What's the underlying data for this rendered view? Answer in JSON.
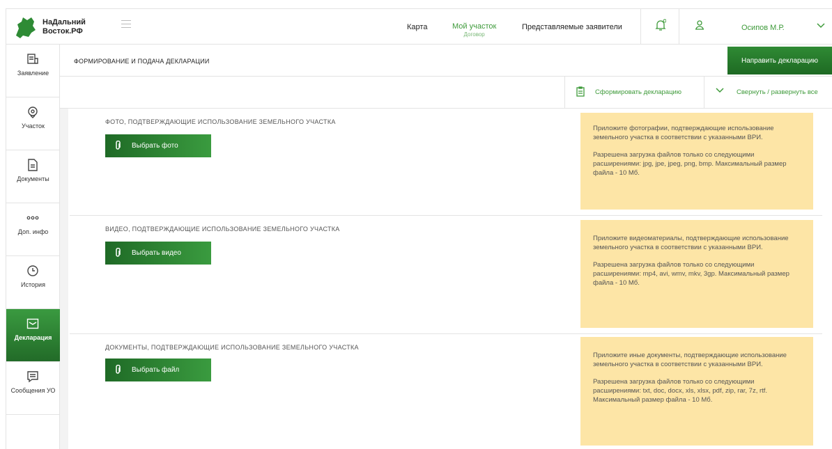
{
  "header": {
    "brand_line1": "НаДальний",
    "brand_line2": "Восток.РФ",
    "nav_map": "Карта",
    "nav_plot": "Мой участок",
    "nav_plot_sub": "Договор",
    "nav_applicants": "Представляемые заявители",
    "user_name": "Осипов М.Р."
  },
  "sidebar": {
    "items": [
      {
        "label": "Заявление",
        "icon": "application-icon"
      },
      {
        "label": "Участок",
        "icon": "location-pin-icon"
      },
      {
        "label": "Документы",
        "icon": "document-icon"
      },
      {
        "label": "Доп. инфо",
        "icon": "more-dots-icon"
      },
      {
        "label": "История",
        "icon": "clock-icon"
      },
      {
        "label": "Декларация",
        "icon": "declaration-icon"
      },
      {
        "label": "Сообщения УО",
        "icon": "messages-icon"
      }
    ],
    "active_index": 5
  },
  "main": {
    "title": "ФОРМИРОВАНИЕ И ПОДАЧА ДЕКЛАРАЦИИ",
    "send_button": "Направить декларацию",
    "form_declaration": "Сформировать декларацию",
    "collapse_expand": "Свернуть / развернуть все",
    "sections": [
      {
        "title": "ФОТО, ПОДТВЕРЖДАЮЩИЕ ИСПОЛЬЗОВАНИЕ ЗЕМЕЛЬНОГО УЧАСТКА",
        "button": "Выбрать фото",
        "note1": "Приложите фотографии, подтверждающие использование земельного участка в соответствии с указанными ВРИ.",
        "note2": "Разрешена загрузка файлов только со следующими расширениями: jpg, jpe, jpeg, png, bmp. Максимальный размер файла - 10 Мб."
      },
      {
        "title": "ВИДЕО, ПОДТВЕРЖДАЮЩИЕ ИСПОЛЬЗОВАНИЕ ЗЕМЕЛЬНОГО УЧАСТКА",
        "button": "Выбрать видео",
        "note1": "Приложите видеоматериалы, подтверждающие использование земельного участка в соответствии с указанными ВРИ.",
        "note2": "Разрешена загрузка файлов только со следующими расширениями: mp4, avi, wmv, mkv, 3gp. Максимальный размер файла - 10 Мб."
      },
      {
        "title": "ДОКУМЕНТЫ, ПОДТВЕРЖДАЮЩИЕ ИСПОЛЬЗОВАНИЕ ЗЕМЕЛЬНОГО УЧАСТКА",
        "button": "Выбрать файл",
        "note1": "Приложите иные документы, подтверждающие использование земельного участка в соответствии с указанными ВРИ.",
        "note2": "Разрешена загрузка файлов только со следующими расширениями: txt, doc, docx, xls, xlsx, pdf, zip, rar, 7z, rtf. Максимальный размер файла - 10 Мб."
      }
    ]
  },
  "colors": {
    "accent_green": "#2f8a34",
    "link_green": "#3e9a3a",
    "note_bg": "#fde5a6"
  }
}
